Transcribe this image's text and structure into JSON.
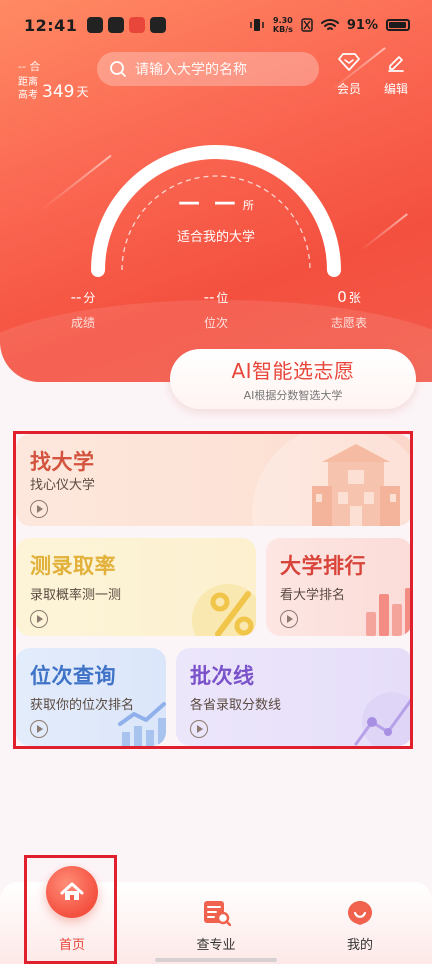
{
  "status_bar": {
    "time": "12:41",
    "net_speed_value": "9.30",
    "net_speed_unit": "KB/s",
    "battery": "91%"
  },
  "header": {
    "exam_countdown": {
      "sub": "-- 合",
      "label": "距离高考",
      "days": "349",
      "unit": "天"
    },
    "search_placeholder": "请输入大学的名称",
    "member_label": "会员",
    "edit_label": "编辑"
  },
  "gauge": {
    "count": "— —",
    "count_unit": "所",
    "label": "适合我的大学"
  },
  "stats": [
    {
      "value": "--",
      "unit": "分",
      "caption": "成绩"
    },
    {
      "value": "--",
      "unit": "位",
      "caption": "位次"
    },
    {
      "value": "0",
      "unit": "张",
      "caption": "志愿表"
    }
  ],
  "ai_card": {
    "title": "AI智能选志愿",
    "subtitle": "AI根据分数智选大学"
  },
  "features": {
    "find_university": {
      "title": "找大学",
      "subtitle": "找心仪大学"
    },
    "admission_rate": {
      "title": "测录取率",
      "subtitle": "录取概率测一测"
    },
    "ranking": {
      "title": "大学排行",
      "subtitle": "看大学排名"
    },
    "rank_query": {
      "title": "位次查询",
      "subtitle": "获取你的位次排名"
    },
    "batch_line": {
      "title": "批次线",
      "subtitle": "各省录取分数线"
    }
  },
  "bottom_nav": [
    {
      "label": "首页",
      "active": true
    },
    {
      "label": "查专业",
      "active": false
    },
    {
      "label": "我的",
      "active": false
    }
  ],
  "colors": {
    "brand_red": "#e8463a",
    "selection_outline": "#e0202c"
  }
}
